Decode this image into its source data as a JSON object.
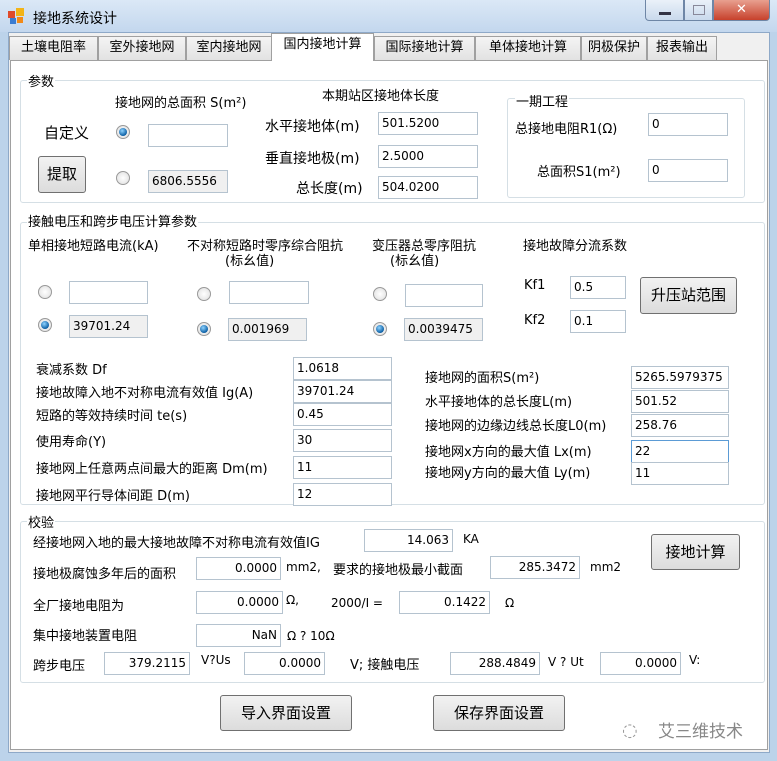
{
  "window": {
    "title": "接地系统设计"
  },
  "tabs": [
    "土壤电阻率",
    "室外接地网",
    "室内接地网",
    "国内接地计算",
    "国际接地计算",
    "单体接地计算",
    "阴极保护",
    "报表输出"
  ],
  "params": {
    "title": "参数",
    "area_label": "接地网的总面积 S(m²)",
    "custom_label": "自定义",
    "custom_value": "",
    "extract_button": "提取",
    "extracted_value": "6806.5556",
    "length_title": "本期站区接地体长度",
    "horiz_label": "水平接地体(m)",
    "horiz_value": "501.5200",
    "vert_label": "垂直接地极(m)",
    "vert_value": "2.5000",
    "total_label": "总长度(m)",
    "total_value": "504.0200",
    "phase1": {
      "title": "一期工程",
      "r1_label": "总接地电阻R1(Ω)",
      "r1_value": "0",
      "s1_label": "总面积S1(m²)",
      "s1_value": "0"
    }
  },
  "voltage": {
    "title": "接触电压和跨步电压计算参数",
    "col1": "单相接地短路电流(kA)",
    "col2": "不对称短路时零序综合阻抗",
    "col2b": "(标幺值)",
    "col3": "变压器总零序阻抗",
    "col3b": "(标幺值)",
    "col4": "接地故障分流系数",
    "c1_custom": "",
    "c1_value": "39701.24",
    "c2_custom": "",
    "c2_value": "0.001969",
    "c3_custom": "",
    "c3_value": "0.0039475",
    "kf1_label": "Kf1",
    "kf1_value": "0.5",
    "kf2_label": "Kf2",
    "kf2_value": "0.1",
    "range_button": "升压站范围",
    "left": [
      {
        "label": "衰减系数   Df",
        "value": "1.0618"
      },
      {
        "label": "接地故障入地不对称电流有效值 Ig(A)",
        "value": "39701.24"
      },
      {
        "label": "短路的等效持续时间 te(s)",
        "value": "0.45"
      },
      {
        "label": "使用寿命(Y)",
        "value": "30"
      },
      {
        "label": "接地网上任意两点间最大的距离 Dm(m)",
        "value": "11"
      },
      {
        "label": "接地网平行导体间距 D(m)",
        "value": "12"
      }
    ],
    "right": [
      {
        "label": "接地网的面积S(m²)",
        "value": "5265.5979375"
      },
      {
        "label": "水平接地体的总长度L(m)",
        "value": "501.52"
      },
      {
        "label": "接地网的边缘边线总长度L0(m)",
        "value": "258.76"
      },
      {
        "label": "接地网x方向的最大值  Lx(m)",
        "value": "22"
      },
      {
        "label": "接地网y方向的最大值  Ly(m)",
        "value": "11"
      }
    ]
  },
  "check": {
    "title": "校验",
    "ig_label": "经接地网入地的最大接地故障不对称电流有效值IG",
    "ig_value": "14.063",
    "ig_unit": "KA",
    "calc_button": "接地计算",
    "corr_label": "接地极腐蚀多年后的面积",
    "corr_value": "0.0000",
    "corr_unit": "mm2,",
    "min_label": "要求的接地极最小截面",
    "min_value": "285.3472",
    "min_unit": "mm2",
    "plant_label": "全厂接地电阻为",
    "plant_value": "0.0000",
    "plant_unit": "Ω,",
    "ratio_label": "2000/I =",
    "ratio_value": "0.1422",
    "ratio_unit": "Ω",
    "central_label": "集中接地装置电阻",
    "central_value": "NaN",
    "central_unit": "Ω  ?  10Ω",
    "step_label": "跨步电压",
    "step_value": "379.2115",
    "us_label": "V?Us",
    "us_value": "0.0000",
    "touch_label": "V;  接触电压",
    "touch_value": "288.4849",
    "ut_label": "V ? Ut",
    "ut_value": "0.0000",
    "end_unit": "V:"
  },
  "footer": {
    "import_button": "导入界面设置",
    "save_button": "保存界面设置",
    "watermark": "艾三维技术"
  }
}
